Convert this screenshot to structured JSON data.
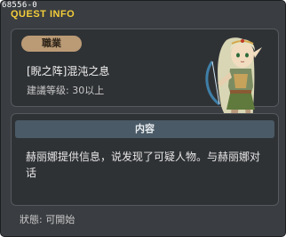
{
  "window": {
    "id": "68556-0",
    "title": "QUEST INFO"
  },
  "job_panel": {
    "badge_label": "職業",
    "quest_name": "[睨之阵]混沌之息",
    "level_requirement": "建議等级: 30以上"
  },
  "content_panel": {
    "header_label": "内容",
    "text": "赫丽娜提供信息，说发现了可疑人物。与赫丽娜对话"
  },
  "status": {
    "text": "狀態: 可開始"
  },
  "colors": {
    "title": "#f3ce3a",
    "badge": "#bb9b76",
    "header": "#4a5a66",
    "window_bg": "#3a3d41"
  },
  "icons": {
    "close": "close-icon",
    "portrait": "npc-portrait"
  }
}
